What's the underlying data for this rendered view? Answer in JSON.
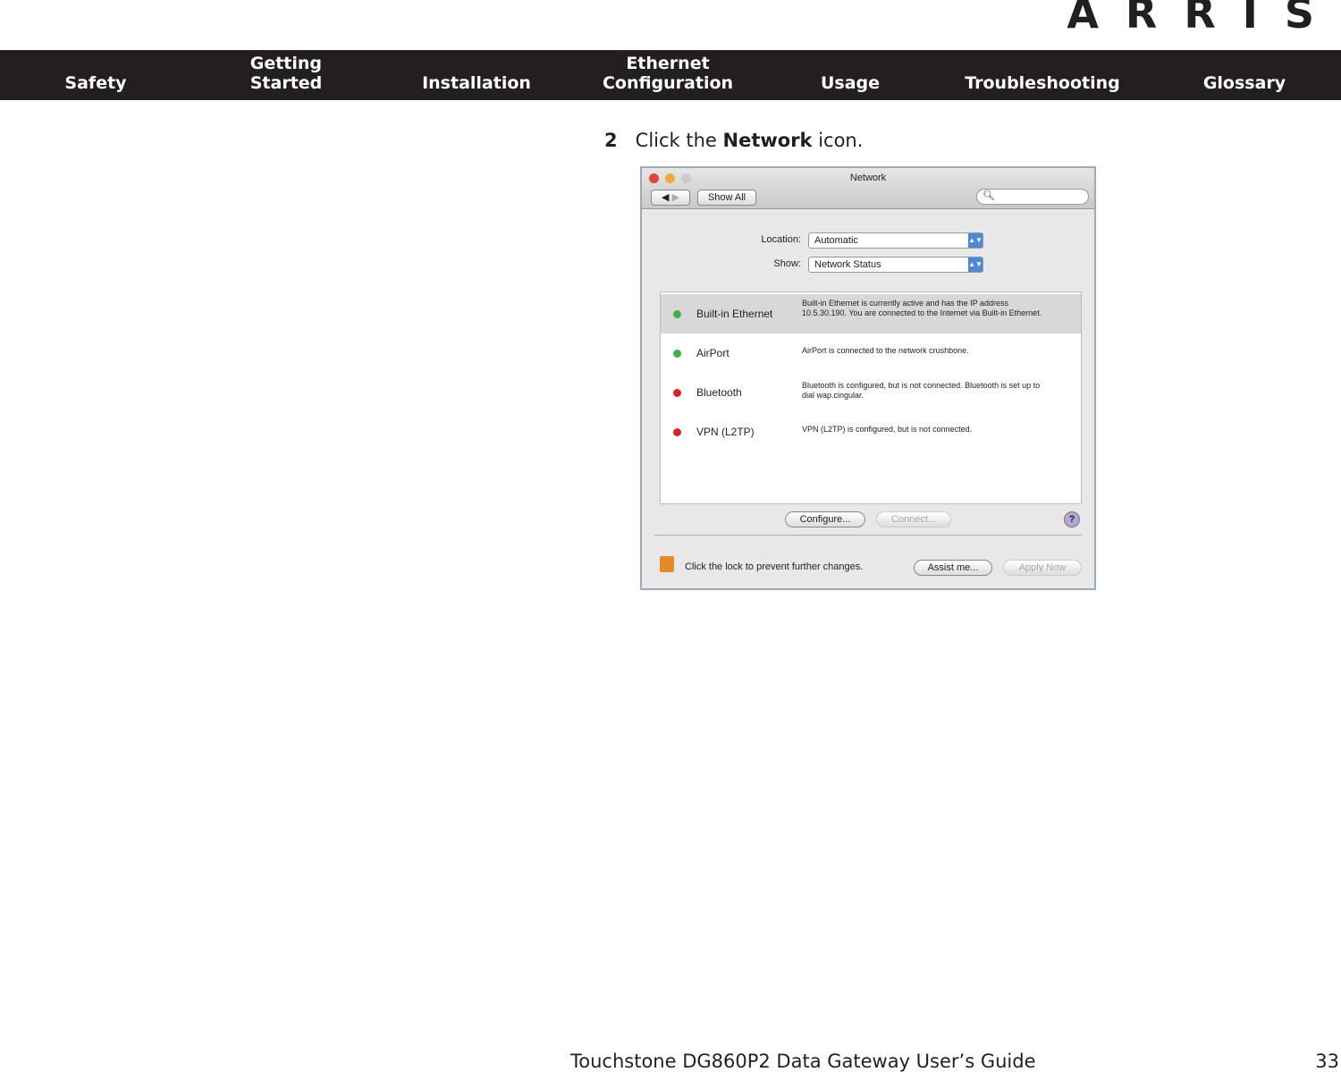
{
  "logo": "ARRIS",
  "nav": [
    "Safety",
    "Getting\nStarted",
    "Installation",
    "Ethernet\nConfiguration",
    "Usage",
    "Troubleshooting",
    "Glossary"
  ],
  "step": {
    "number": "2",
    "pre": "Click the ",
    "bold": "Network",
    "post": " icon."
  },
  "window": {
    "title": "Network",
    "show_all": "Show All",
    "location_label": "Location:",
    "location_value": "Automatic",
    "show_label": "Show:",
    "show_value": "Network Status",
    "services": [
      {
        "name": "Built-in Ethernet",
        "status": "green",
        "desc": "Built-in Ethernet is currently active and has the IP address 10.5.30.190. You are connected to the Internet via Built-in Ethernet."
      },
      {
        "name": "AirPort",
        "status": "green",
        "desc": "AirPort is connected to the network crushbone."
      },
      {
        "name": "Bluetooth",
        "status": "red",
        "desc": "Bluetooth is configured, but is not connected. Bluetooth is set up to dial wap.cingular."
      },
      {
        "name": "VPN (L2TP)",
        "status": "red",
        "desc": "VPN (L2TP) is configured, but is not connected."
      }
    ],
    "configure": "Configure...",
    "connect": "Connect...",
    "help": "?",
    "lock_text": "Click the lock to prevent further changes.",
    "assist": "Assist me...",
    "apply": "Apply Now"
  },
  "colors": {
    "green": "#3cb043",
    "red": "#e02020",
    "nav_bg": "#231f20"
  },
  "footer": {
    "title": "Touchstone DG860P2 Data Gateway User’s Guide",
    "page": "33"
  }
}
